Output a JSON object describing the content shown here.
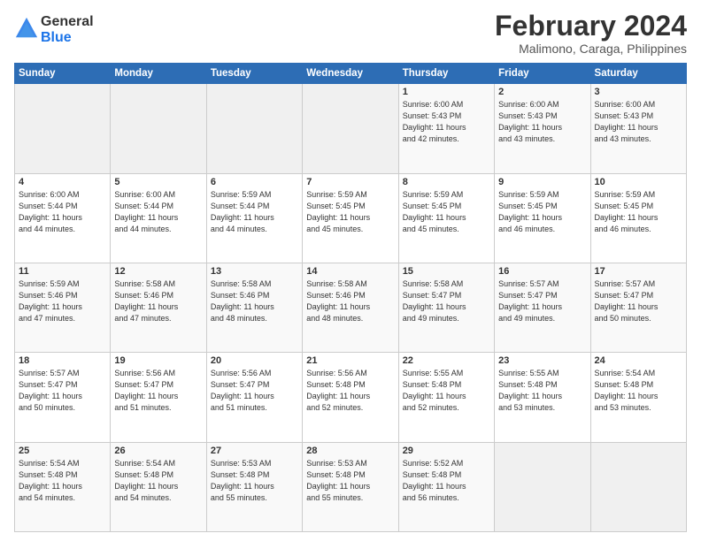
{
  "logo": {
    "general": "General",
    "blue": "Blue"
  },
  "title": "February 2024",
  "subtitle": "Malimono, Caraga, Philippines",
  "headers": [
    "Sunday",
    "Monday",
    "Tuesday",
    "Wednesday",
    "Thursday",
    "Friday",
    "Saturday"
  ],
  "weeks": [
    [
      {
        "day": "",
        "info": ""
      },
      {
        "day": "",
        "info": ""
      },
      {
        "day": "",
        "info": ""
      },
      {
        "day": "",
        "info": ""
      },
      {
        "day": "1",
        "info": "Sunrise: 6:00 AM\nSunset: 5:43 PM\nDaylight: 11 hours\nand 42 minutes."
      },
      {
        "day": "2",
        "info": "Sunrise: 6:00 AM\nSunset: 5:43 PM\nDaylight: 11 hours\nand 43 minutes."
      },
      {
        "day": "3",
        "info": "Sunrise: 6:00 AM\nSunset: 5:43 PM\nDaylight: 11 hours\nand 43 minutes."
      }
    ],
    [
      {
        "day": "4",
        "info": "Sunrise: 6:00 AM\nSunset: 5:44 PM\nDaylight: 11 hours\nand 44 minutes."
      },
      {
        "day": "5",
        "info": "Sunrise: 6:00 AM\nSunset: 5:44 PM\nDaylight: 11 hours\nand 44 minutes."
      },
      {
        "day": "6",
        "info": "Sunrise: 5:59 AM\nSunset: 5:44 PM\nDaylight: 11 hours\nand 44 minutes."
      },
      {
        "day": "7",
        "info": "Sunrise: 5:59 AM\nSunset: 5:45 PM\nDaylight: 11 hours\nand 45 minutes."
      },
      {
        "day": "8",
        "info": "Sunrise: 5:59 AM\nSunset: 5:45 PM\nDaylight: 11 hours\nand 45 minutes."
      },
      {
        "day": "9",
        "info": "Sunrise: 5:59 AM\nSunset: 5:45 PM\nDaylight: 11 hours\nand 46 minutes."
      },
      {
        "day": "10",
        "info": "Sunrise: 5:59 AM\nSunset: 5:45 PM\nDaylight: 11 hours\nand 46 minutes."
      }
    ],
    [
      {
        "day": "11",
        "info": "Sunrise: 5:59 AM\nSunset: 5:46 PM\nDaylight: 11 hours\nand 47 minutes."
      },
      {
        "day": "12",
        "info": "Sunrise: 5:58 AM\nSunset: 5:46 PM\nDaylight: 11 hours\nand 47 minutes."
      },
      {
        "day": "13",
        "info": "Sunrise: 5:58 AM\nSunset: 5:46 PM\nDaylight: 11 hours\nand 48 minutes."
      },
      {
        "day": "14",
        "info": "Sunrise: 5:58 AM\nSunset: 5:46 PM\nDaylight: 11 hours\nand 48 minutes."
      },
      {
        "day": "15",
        "info": "Sunrise: 5:58 AM\nSunset: 5:47 PM\nDaylight: 11 hours\nand 49 minutes."
      },
      {
        "day": "16",
        "info": "Sunrise: 5:57 AM\nSunset: 5:47 PM\nDaylight: 11 hours\nand 49 minutes."
      },
      {
        "day": "17",
        "info": "Sunrise: 5:57 AM\nSunset: 5:47 PM\nDaylight: 11 hours\nand 50 minutes."
      }
    ],
    [
      {
        "day": "18",
        "info": "Sunrise: 5:57 AM\nSunset: 5:47 PM\nDaylight: 11 hours\nand 50 minutes."
      },
      {
        "day": "19",
        "info": "Sunrise: 5:56 AM\nSunset: 5:47 PM\nDaylight: 11 hours\nand 51 minutes."
      },
      {
        "day": "20",
        "info": "Sunrise: 5:56 AM\nSunset: 5:47 PM\nDaylight: 11 hours\nand 51 minutes."
      },
      {
        "day": "21",
        "info": "Sunrise: 5:56 AM\nSunset: 5:48 PM\nDaylight: 11 hours\nand 52 minutes."
      },
      {
        "day": "22",
        "info": "Sunrise: 5:55 AM\nSunset: 5:48 PM\nDaylight: 11 hours\nand 52 minutes."
      },
      {
        "day": "23",
        "info": "Sunrise: 5:55 AM\nSunset: 5:48 PM\nDaylight: 11 hours\nand 53 minutes."
      },
      {
        "day": "24",
        "info": "Sunrise: 5:54 AM\nSunset: 5:48 PM\nDaylight: 11 hours\nand 53 minutes."
      }
    ],
    [
      {
        "day": "25",
        "info": "Sunrise: 5:54 AM\nSunset: 5:48 PM\nDaylight: 11 hours\nand 54 minutes."
      },
      {
        "day": "26",
        "info": "Sunrise: 5:54 AM\nSunset: 5:48 PM\nDaylight: 11 hours\nand 54 minutes."
      },
      {
        "day": "27",
        "info": "Sunrise: 5:53 AM\nSunset: 5:48 PM\nDaylight: 11 hours\nand 55 minutes."
      },
      {
        "day": "28",
        "info": "Sunrise: 5:53 AM\nSunset: 5:48 PM\nDaylight: 11 hours\nand 55 minutes."
      },
      {
        "day": "29",
        "info": "Sunrise: 5:52 AM\nSunset: 5:48 PM\nDaylight: 11 hours\nand 56 minutes."
      },
      {
        "day": "",
        "info": ""
      },
      {
        "day": "",
        "info": ""
      }
    ]
  ]
}
